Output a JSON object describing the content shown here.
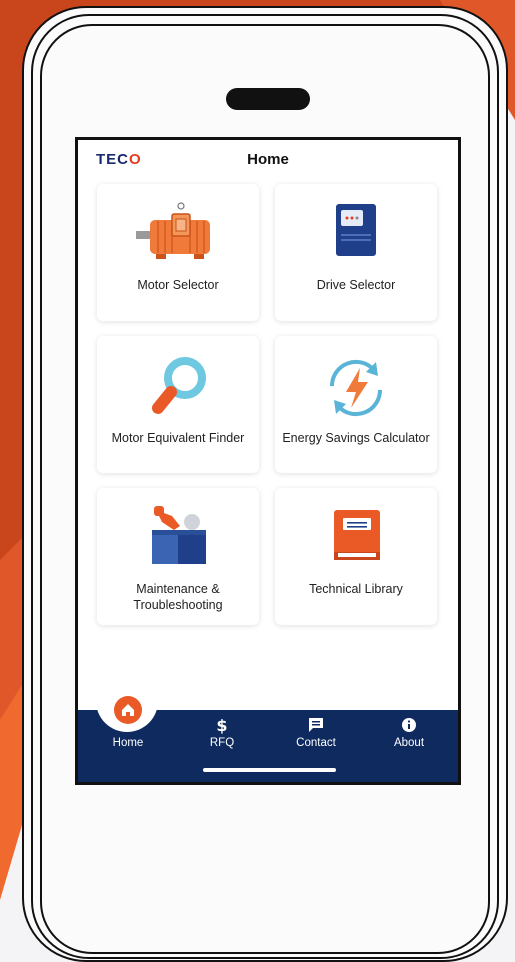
{
  "app": {
    "logo": "TECO",
    "title": "Home"
  },
  "cards": [
    {
      "label": "Motor Selector",
      "icon": "motor-icon"
    },
    {
      "label": "Drive Selector",
      "icon": "drive-icon"
    },
    {
      "label": "Motor Equivalent Finder",
      "icon": "magnifier-icon"
    },
    {
      "label": "Energy Savings Calculator",
      "icon": "energy-icon"
    },
    {
      "label": "Maintenance & Troubleshooting",
      "icon": "toolbox-icon"
    },
    {
      "label": "Technical Library",
      "icon": "book-icon"
    }
  ],
  "nav": {
    "items": [
      {
        "label": "Home",
        "icon": "home-icon",
        "active": true
      },
      {
        "label": "RFQ",
        "icon": "dollar-icon",
        "active": false
      },
      {
        "label": "Contact",
        "icon": "message-icon",
        "active": false
      },
      {
        "label": "About",
        "icon": "info-icon",
        "active": false
      }
    ]
  },
  "colors": {
    "brand_navy": "#0f2a5f",
    "accent_orange": "#ea5a27",
    "logo_blue": "#1a2a6e",
    "logo_red": "#e53b1f"
  }
}
